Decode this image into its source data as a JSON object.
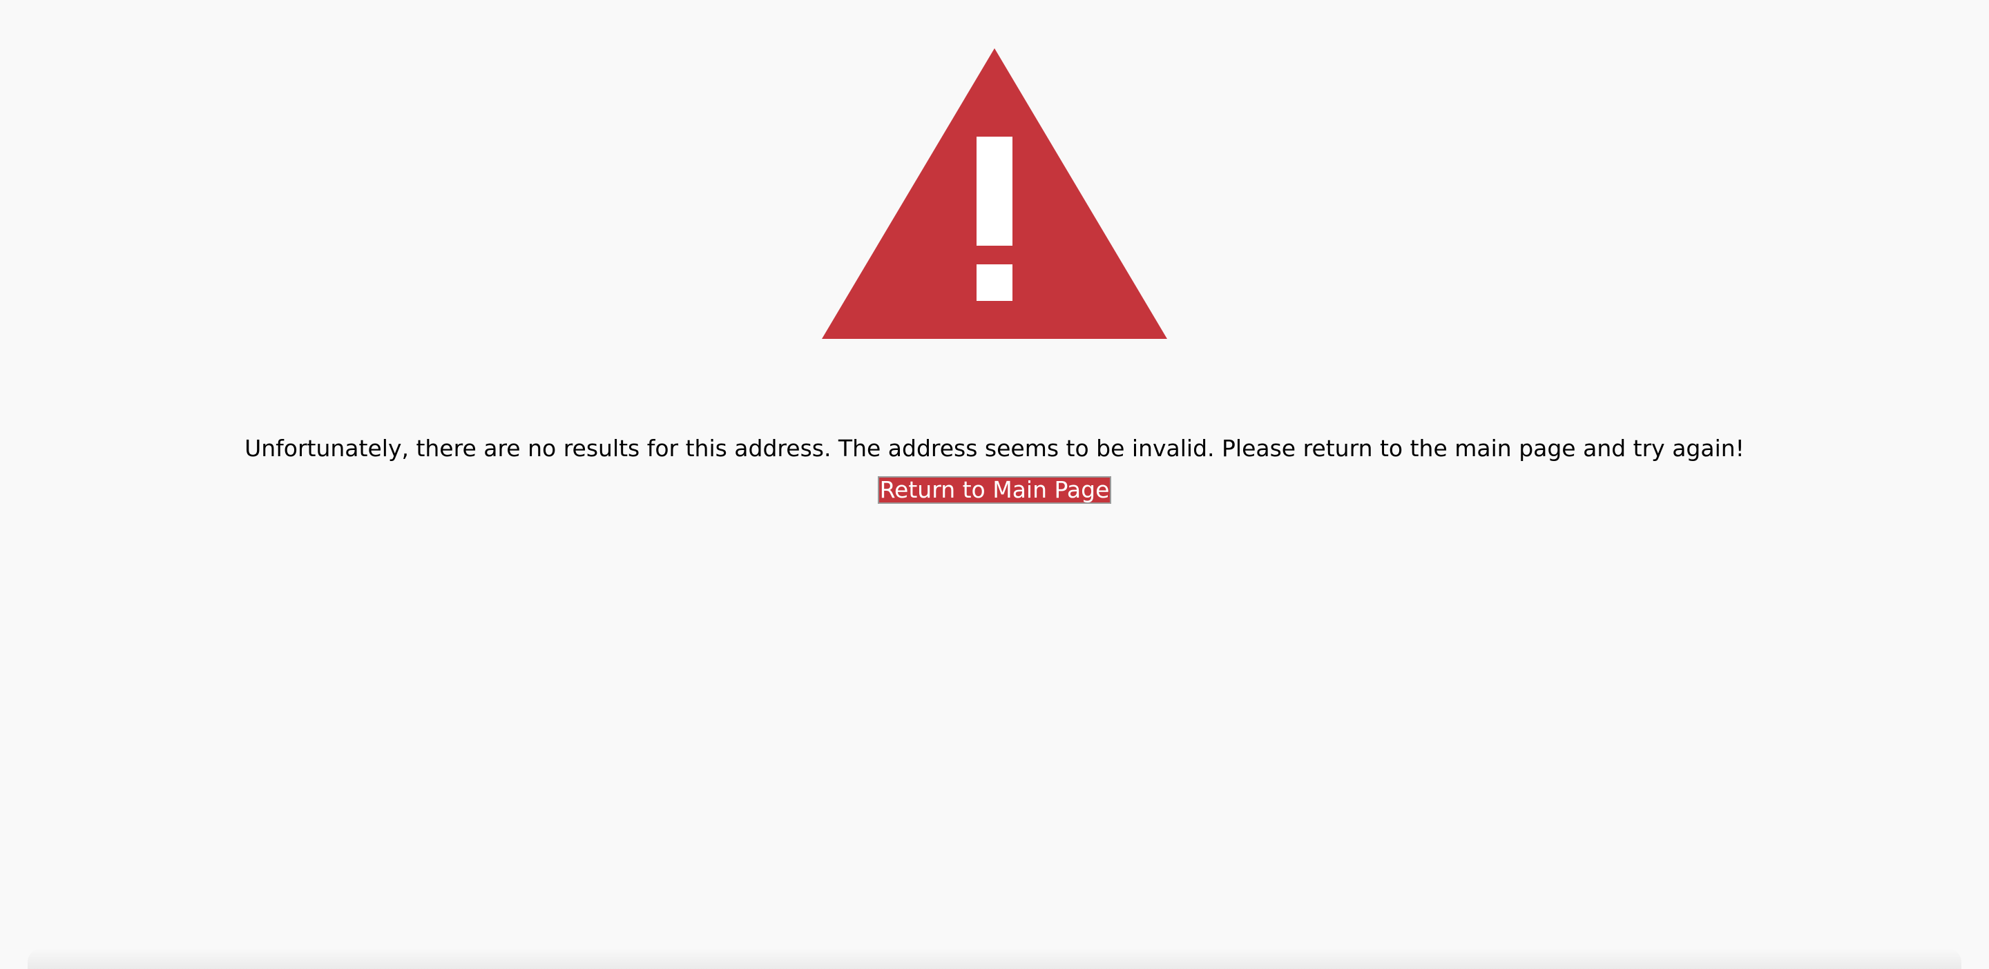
{
  "colors": {
    "background": "#f9f9f9",
    "accent": "#c5353c",
    "text": "#000000",
    "button_text": "#ffffff"
  },
  "warning": {
    "icon": "warning-triangle-icon"
  },
  "message": {
    "text": "Unfortunately, there are no results for this address. The address seems to be invalid. Please return to the main page and try again!"
  },
  "button": {
    "label": "Return to Main Page"
  }
}
